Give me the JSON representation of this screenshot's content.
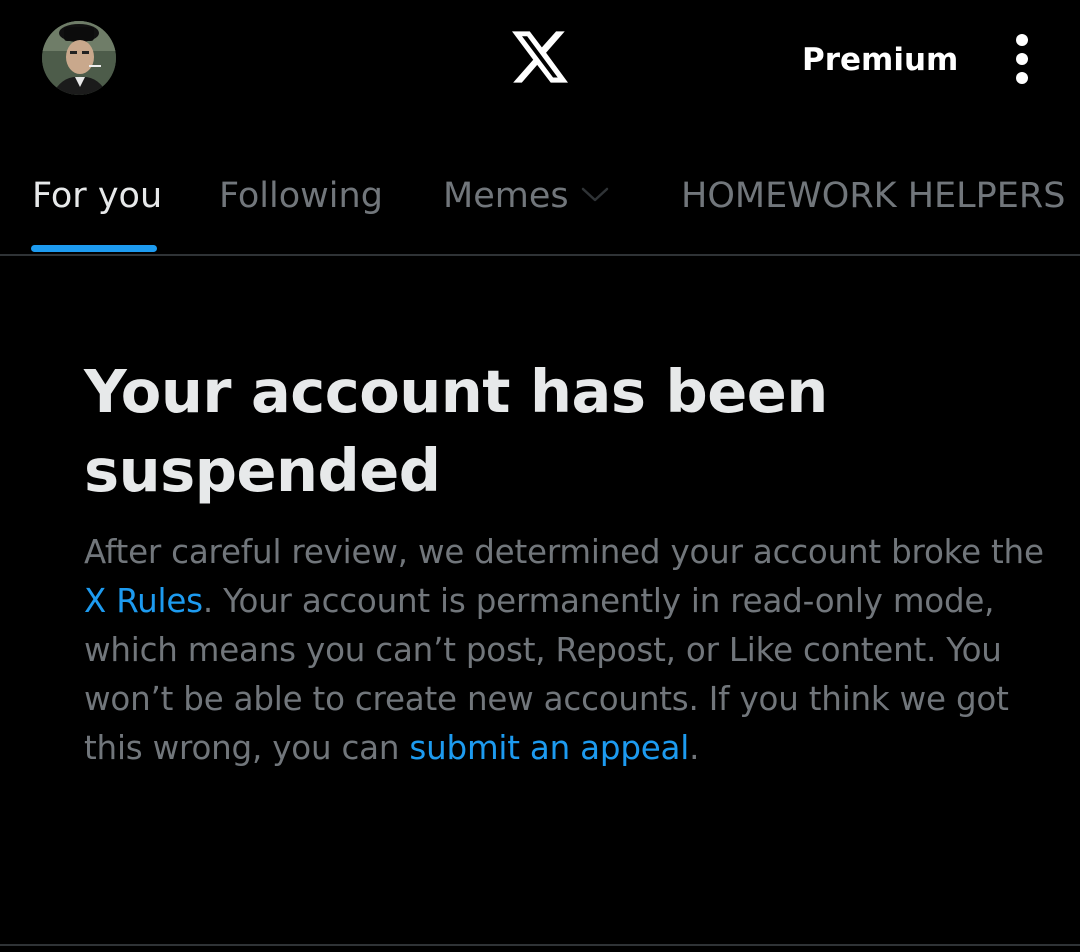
{
  "header": {
    "premium_label": "Premium",
    "logo_icon": "x-logo-icon",
    "menu_icon": "more-vertical-icon"
  },
  "tabs": [
    {
      "label": "For you",
      "active": true
    },
    {
      "label": "Following",
      "active": false
    },
    {
      "label": "Memes",
      "active": false,
      "has_dropdown": true
    },
    {
      "label": "HOMEWORK HELPERS",
      "active": false
    }
  ],
  "notice": {
    "title": "Your account has been suspended",
    "body_part1": "After careful review, we determined your account broke the ",
    "rules_link": "X Rules",
    "body_part2": ". Your account is permanently in read-only mode, which means you can’t post, Repost, or Like content. You won’t be able to create new accounts. If you think we got this wrong, you can ",
    "appeal_link": "submit an appeal",
    "body_end": "."
  },
  "colors": {
    "background": "#000000",
    "primary_text": "#e7e9ea",
    "secondary_text": "#71767b",
    "accent": "#1d9bf0",
    "divider": "#2f3336"
  }
}
